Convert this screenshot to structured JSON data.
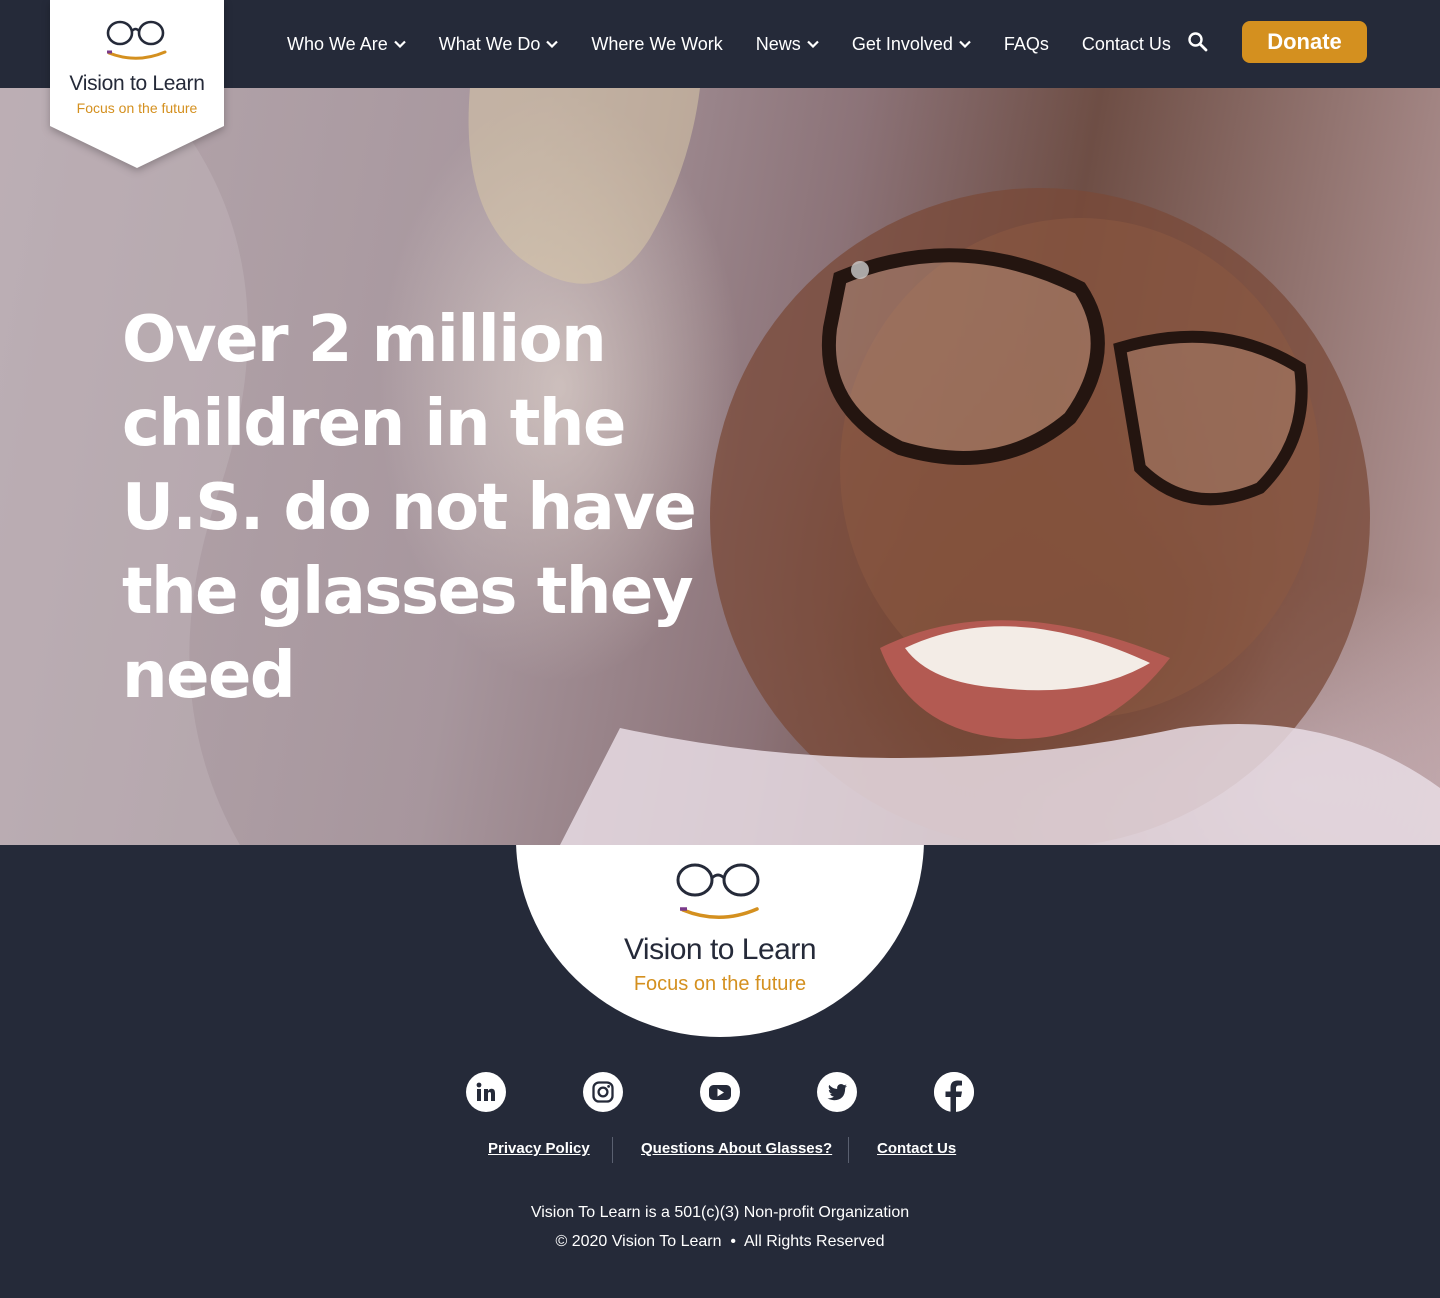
{
  "brand": {
    "name": "Vision to Learn",
    "tagline": "Focus on the future",
    "accent": "#d4901f",
    "navy": "#252a39"
  },
  "nav": {
    "items": [
      {
        "label": "Who We Are",
        "has_dropdown": true
      },
      {
        "label": "What We Do",
        "has_dropdown": true
      },
      {
        "label": "Where We Work",
        "has_dropdown": false
      },
      {
        "label": "News",
        "has_dropdown": true
      },
      {
        "label": "Get Involved",
        "has_dropdown": true
      },
      {
        "label": "FAQs",
        "has_dropdown": false
      },
      {
        "label": "Contact Us",
        "has_dropdown": false
      }
    ],
    "search_icon": "search-icon",
    "donate_label": "Donate"
  },
  "hero": {
    "headline": "Over 2 million children in the U.S. do not have the glasses they need"
  },
  "footer": {
    "social": [
      "linkedin-icon",
      "instagram-icon",
      "youtube-icon",
      "twitter-icon",
      "facebook-icon"
    ],
    "links": {
      "privacy": "Privacy Policy",
      "glasses": "Questions About Glasses?",
      "contact": "Contact Us"
    },
    "legal_line1": "Vision To Learn is a 501(c)(3) Non-profit Organization",
    "legal_line2": "© 2020 Vision To Learn  •  All Rights Reserved"
  }
}
